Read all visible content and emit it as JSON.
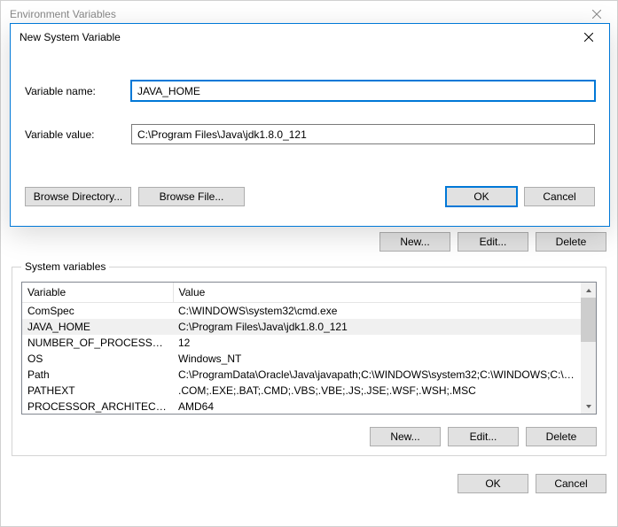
{
  "parent_window": {
    "title": "Environment Variables"
  },
  "user_section_buttons": {
    "new": "New...",
    "edit": "Edit...",
    "delete": "Delete"
  },
  "sysvars": {
    "legend": "System variables",
    "headers": {
      "variable": "Variable",
      "value": "Value"
    },
    "rows": [
      {
        "name": "ComSpec",
        "value": "C:\\WINDOWS\\system32\\cmd.exe",
        "selected": false
      },
      {
        "name": "JAVA_HOME",
        "value": "C:\\Program Files\\Java\\jdk1.8.0_121",
        "selected": true
      },
      {
        "name": "NUMBER_OF_PROCESSORS",
        "value": "12",
        "selected": false
      },
      {
        "name": "OS",
        "value": "Windows_NT",
        "selected": false
      },
      {
        "name": "Path",
        "value": "C:\\ProgramData\\Oracle\\Java\\javapath;C:\\WINDOWS\\system32;C:\\WINDOWS;C:\\WI...",
        "selected": false
      },
      {
        "name": "PATHEXT",
        "value": ".COM;.EXE;.BAT;.CMD;.VBS;.VBE;.JS;.JSE;.WSF;.WSH;.MSC",
        "selected": false
      },
      {
        "name": "PROCESSOR_ARCHITECTURE",
        "value": "AMD64",
        "selected": false
      }
    ],
    "buttons": {
      "new": "New...",
      "edit": "Edit...",
      "delete": "Delete"
    }
  },
  "bottom_buttons": {
    "ok": "OK",
    "cancel": "Cancel"
  },
  "modal": {
    "title": "New System Variable",
    "labels": {
      "name": "Variable name:",
      "value": "Variable value:"
    },
    "inputs": {
      "name": "JAVA_HOME",
      "value": "C:\\Program Files\\Java\\jdk1.8.0_121"
    },
    "buttons": {
      "browse_dir": "Browse Directory...",
      "browse_file": "Browse File...",
      "ok": "OK",
      "cancel": "Cancel"
    }
  }
}
